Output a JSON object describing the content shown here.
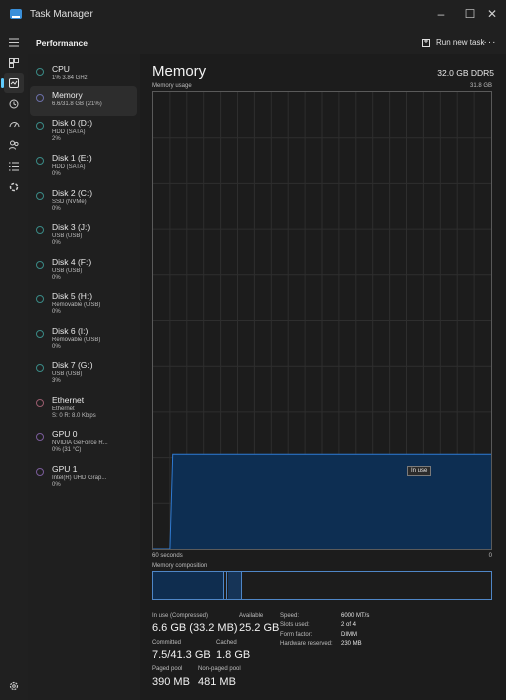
{
  "window": {
    "title": "Task Manager",
    "controls": {
      "minimize": "–",
      "maximize": "☐",
      "close": "✕"
    }
  },
  "header": {
    "title": "Performance",
    "run_task": "Run new task",
    "more": "···"
  },
  "rail": {
    "icons": [
      "menu-icon",
      "processes-icon",
      "performance-icon",
      "app-history-icon",
      "startup-apps-icon",
      "users-icon",
      "details-icon",
      "services-icon"
    ],
    "settings": "settings-icon"
  },
  "devices": [
    {
      "name": "CPU",
      "lines": [
        "1% 3.84 GHz"
      ]
    },
    {
      "name": "Memory",
      "lines": [
        "6.6/31.8 GB (21%)"
      ]
    },
    {
      "name": "Disk 0 (D:)",
      "lines": [
        "HDD (SATA)",
        "2%"
      ]
    },
    {
      "name": "Disk 1 (E:)",
      "lines": [
        "HDD (SATA)",
        "0%"
      ]
    },
    {
      "name": "Disk 2 (C:)",
      "lines": [
        "SSD (NVMe)",
        "0%"
      ]
    },
    {
      "name": "Disk 3 (J:)",
      "lines": [
        "USB (USB)",
        "0%"
      ]
    },
    {
      "name": "Disk 4 (F:)",
      "lines": [
        "USB (USB)",
        "0%"
      ]
    },
    {
      "name": "Disk 5 (H:)",
      "lines": [
        "Removable (USB)",
        "0%"
      ]
    },
    {
      "name": "Disk 6 (I:)",
      "lines": [
        "Removable (USB)",
        "0%"
      ]
    },
    {
      "name": "Disk 7 (G:)",
      "lines": [
        "USB (USB)",
        "3%"
      ]
    },
    {
      "name": "Ethernet",
      "lines": [
        "Ethernet",
        "S: 0 R: 8.0 Kbps"
      ]
    },
    {
      "name": "GPU 0",
      "lines": [
        "NVIDIA GeForce R...",
        "0% (31 °C)"
      ]
    },
    {
      "name": "GPU 1",
      "lines": [
        "Intel(R) UHD Grap...",
        "0%"
      ]
    }
  ],
  "main": {
    "title": "Memory",
    "spec": "32.0 GB DDR5",
    "usage_label": "Memory usage",
    "usage_max": "31.8 GB",
    "x_left": "60 seconds",
    "x_right": "0",
    "tooltip": "In use",
    "composition_label": "Memory composition"
  },
  "chart_data": {
    "type": "area",
    "title": "Memory usage",
    "xlabel": "",
    "ylabel": "",
    "x": [
      60,
      57,
      56.5,
      56,
      0
    ],
    "values": [
      0,
      0,
      6.6,
      6.6,
      6.6
    ],
    "xlim": [
      60,
      0
    ],
    "ylim": [
      0,
      31.8
    ],
    "grid": true,
    "fill": "#0d2e52",
    "line": "#2f7ad1"
  },
  "stats": {
    "in_use_label": "In use (Compressed)",
    "in_use_value": "6.6 GB (33.2 MB)",
    "available_label": "Available",
    "available_value": "25.2 GB",
    "committed_label": "Committed",
    "committed_value": "7.5/41.3 GB",
    "cached_label": "Cached",
    "cached_value": "1.8 GB",
    "paged_label": "Paged pool",
    "paged_value": "390 MB",
    "nonpaged_label": "Non-paged pool",
    "nonpaged_value": "481 MB",
    "speed_label": "Speed:",
    "speed_value": "6000 MT/s",
    "slots_label": "Slots used:",
    "slots_value": "2 of 4",
    "form_label": "Form factor:",
    "form_value": "DIMM",
    "reserved_label": "Hardware reserved:",
    "reserved_value": "230 MB"
  },
  "colors": {
    "accent": "#60cdff",
    "graph_line": "#2f7ad1",
    "graph_fill": "#0d2e52",
    "device_dot": "#3a8a86"
  }
}
